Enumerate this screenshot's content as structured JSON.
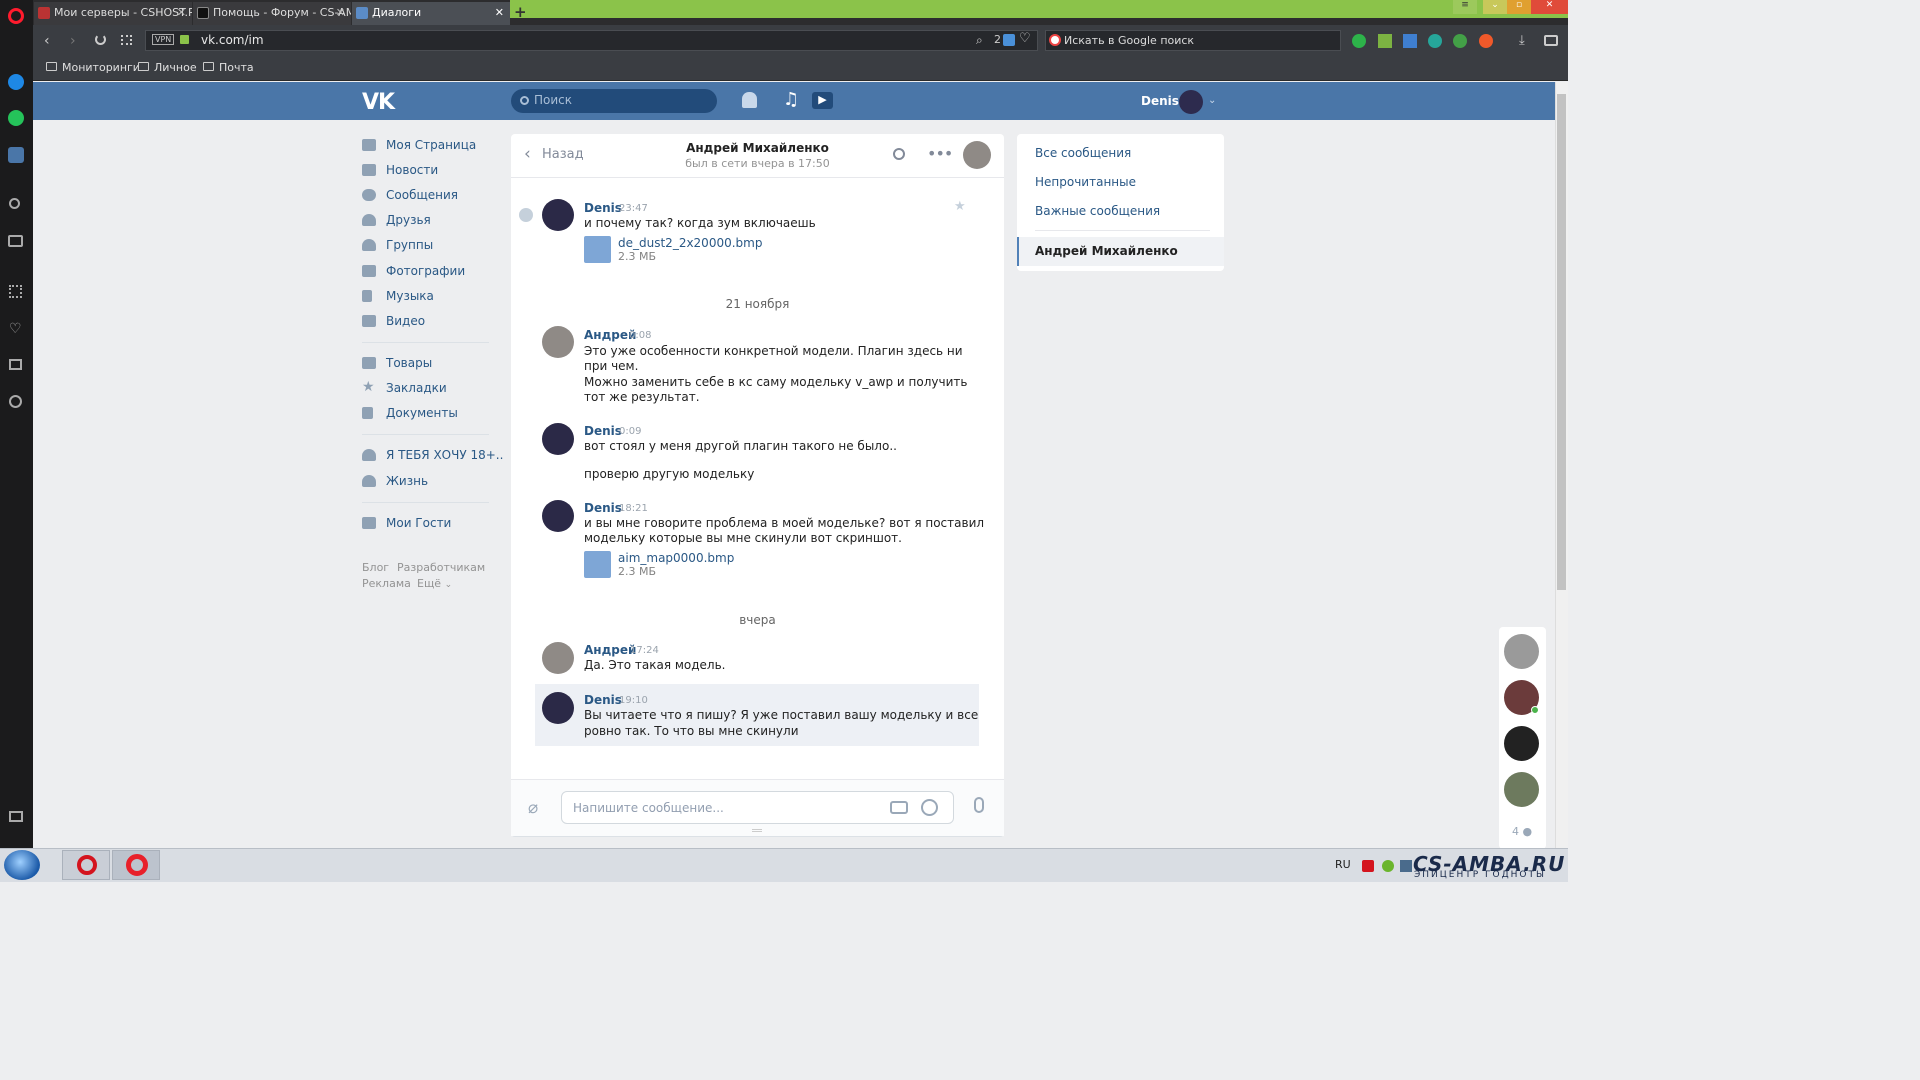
{
  "browser": {
    "tabs": [
      {
        "label": "Мои серверы - CSHOST.R",
        "active": false
      },
      {
        "label": "Помощь - Форум - CS-AM",
        "active": false
      },
      {
        "label": "Диалоги",
        "active": true
      }
    ],
    "new_tab": "+",
    "url": "vk.com/im",
    "vpn_badge": "VPN",
    "ext_count": "2",
    "search_placeholder": "Искать в Google поиск",
    "bookmarks": [
      "Мониторинги",
      "Личное",
      "Почта"
    ]
  },
  "vk": {
    "logo": "VK",
    "search_placeholder": "Поиск",
    "user_name": "Denis",
    "nav": [
      {
        "label": "Моя Страница",
        "icon": "home-icon"
      },
      {
        "label": "Новости",
        "icon": "news-icon"
      },
      {
        "label": "Сообщения",
        "icon": "messages-icon"
      },
      {
        "label": "Друзья",
        "icon": "friends-icon"
      },
      {
        "label": "Группы",
        "icon": "groups-icon"
      },
      {
        "label": "Фотографии",
        "icon": "camera-icon"
      },
      {
        "label": "Музыка",
        "icon": "music-icon"
      },
      {
        "label": "Видео",
        "icon": "video-icon"
      },
      {
        "label": "Товары",
        "icon": "bag-icon"
      },
      {
        "label": "Закладки",
        "icon": "star-icon"
      },
      {
        "label": "Документы",
        "icon": "document-icon"
      },
      {
        "label": "Я ТЕБЯ ХОЧУ 18+..",
        "icon": "group-icon"
      },
      {
        "label": "Жизнь",
        "icon": "group-icon"
      },
      {
        "label": "Мои Гости",
        "icon": "apps-icon"
      }
    ],
    "footer": {
      "blog": "Блог",
      "dev": "Разработчикам",
      "ads": "Реклама",
      "more": "Ещё"
    }
  },
  "chat": {
    "back": "Назад",
    "peer_name": "Андрей Михайленко",
    "peer_status": "был в сети вчера в 17:50",
    "messages": [
      {
        "author": "Denis",
        "time": "23:47",
        "text": "и почему так? когда зум включаешь",
        "file": "de_dust2_2x20000.bmp",
        "size": "2.3 МБ"
      },
      {
        "author": "Андрей",
        "time": "0:08",
        "text1": "Это уже особенности конкретной модели. Плагин здесь ни",
        "text2": "при чем.",
        "text3": "Можно заменить себе в кс саму модельку v_awp и получить",
        "text4": "тот же результат."
      },
      {
        "author": "Denis",
        "time": "0:09",
        "text1": "вот стоял у меня другой плагин такого не было..",
        "text2": "проверю другую модельку"
      },
      {
        "author": "Denis",
        "time": "18:21",
        "text1": "и вы мне говорите проблема в моей модельке? вот я поставил",
        "text2": "модельку которые вы мне скинули вот скриншот.",
        "file": "aim_map0000.bmp",
        "size": "2.3 МБ"
      },
      {
        "author": "Андрей",
        "time": "17:24",
        "text": "Да. Это такая модель."
      },
      {
        "author": "Denis",
        "time": "19:10",
        "text1": "Вы читаете что я пишу? Я уже поставил вашу модельку и все",
        "text2": "ровно так. То что вы мне скинули"
      }
    ],
    "days": [
      "21 ноября",
      "вчера"
    ],
    "composer_placeholder": "Напишите сообщение..."
  },
  "right_menu": {
    "all": "Все сообщения",
    "unread": "Непрочитанные",
    "important": "Важные сообщения",
    "active": "Андрей Михайленко"
  },
  "bubbles_count": "4",
  "taskbar": {
    "lang": "RU"
  },
  "watermark": {
    "main": "CS-AMBA.RU",
    "sub": "ЭПИЦЕНТР ГОДНОТЫ"
  },
  "colors": {
    "vk_blue": "#4a76a8",
    "link": "#2a5885",
    "opera_red": "#ff1b2d"
  }
}
